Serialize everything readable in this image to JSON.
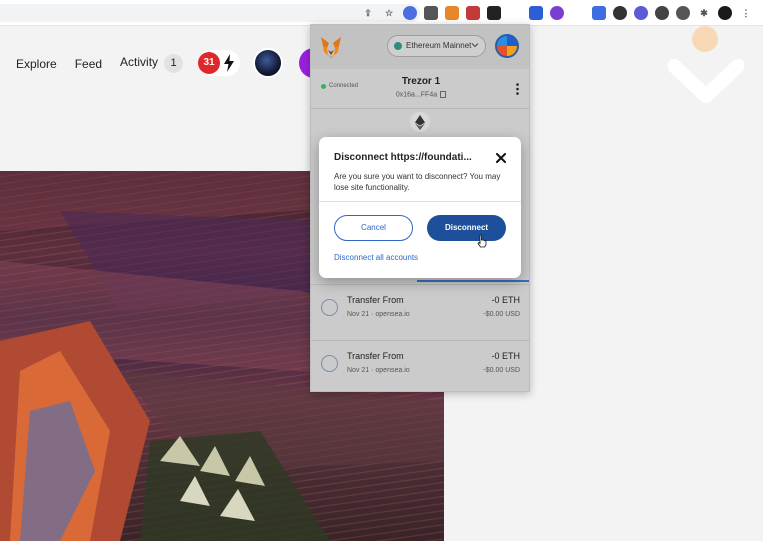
{
  "nav": {
    "explore": "Explore",
    "feed": "Feed",
    "activity": "Activity",
    "activity_count": "1",
    "notification_count": "31"
  },
  "metamask": {
    "network": "Ethereum Mainnet",
    "connected_label": "Connected",
    "account_name": "Trezor 1",
    "account_address": "0x16a...FF4a",
    "activity": [
      {
        "title": "Transfer From",
        "meta": "Nov 21 · opensea.io",
        "amount": "-0 ETH",
        "fiat": "-$0.00 USD"
      },
      {
        "title": "Transfer From",
        "meta": "Nov 21 · opensea.io",
        "amount": "-0 ETH",
        "fiat": "-$0.00 USD"
      }
    ]
  },
  "dialog": {
    "title": "Disconnect https://foundati...",
    "body": "Are you sure you want to disconnect? You may lose site functionality.",
    "cancel": "Cancel",
    "disconnect": "Disconnect",
    "disconnect_all": "Disconnect all accounts"
  },
  "colors": {
    "primary_blue": "#1d4f9b",
    "link_blue": "#2f67c7",
    "badge_red": "#e0282b",
    "connected_green": "#3cae5a"
  }
}
